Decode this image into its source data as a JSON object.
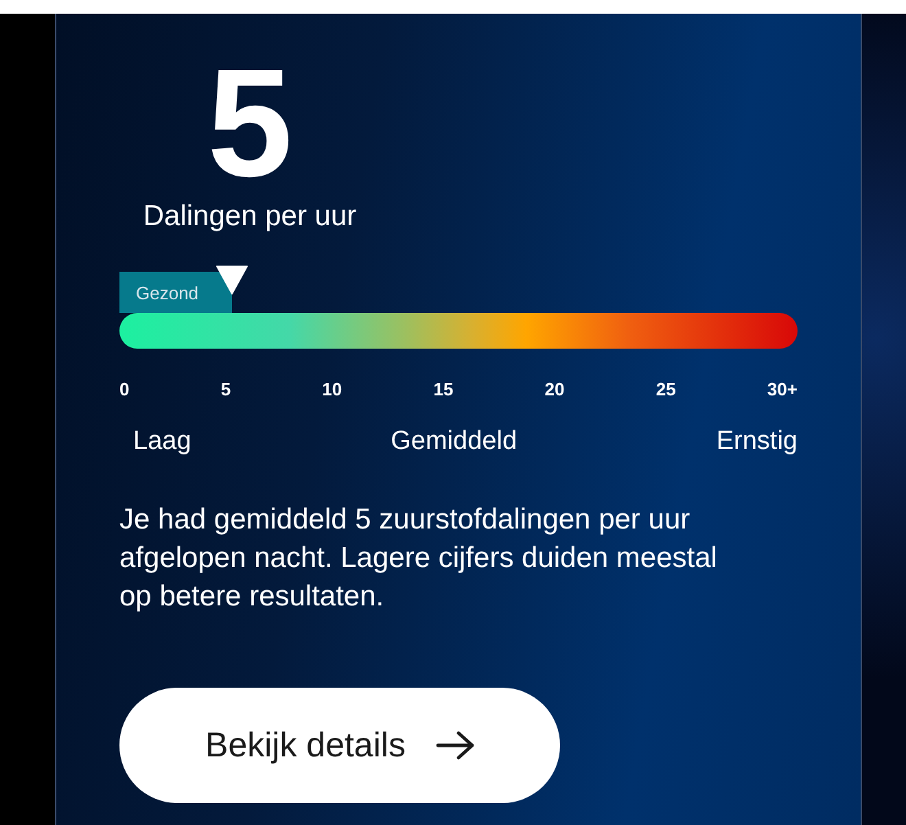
{
  "score": "5",
  "unit": "Dalingen per uur",
  "gauge": {
    "zone": {
      "label": "Gezond",
      "level": 0.1667
    },
    "ticks": [
      "0",
      "5",
      "10",
      "15",
      "20",
      "25",
      "30+"
    ],
    "categories": [
      "Laag",
      "Gemiddeld",
      "Ernstig"
    ]
  },
  "description": "Je had gemiddeld 5 zuurstofdalingen per uur afgelopen nacht. Lagere cijfers duiden meestal op betere resultaten.",
  "button": {
    "label": "Bekijk details"
  }
}
